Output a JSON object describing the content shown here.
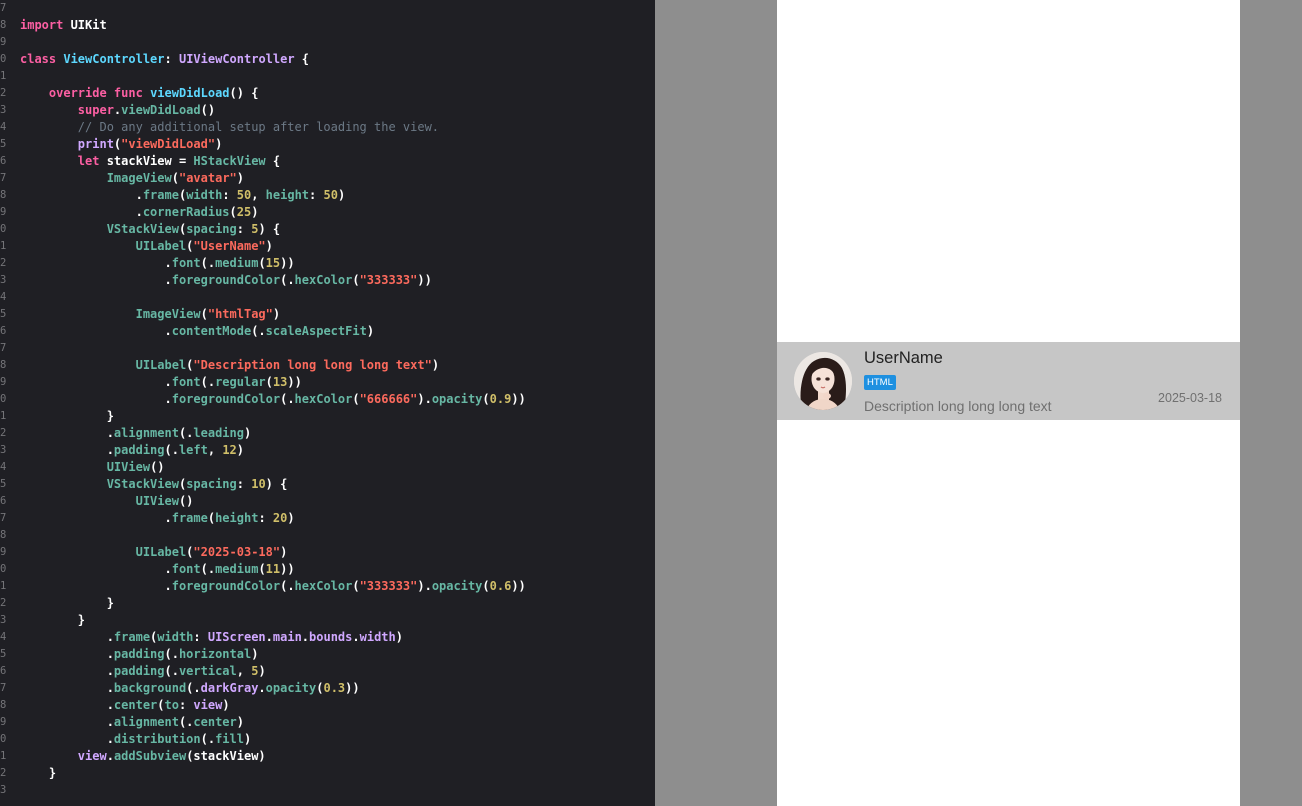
{
  "editor": {
    "lines": [
      {
        "n": "7",
        "tokens": []
      },
      {
        "n": "8",
        "tokens": [
          [
            "kw",
            "import"
          ],
          [
            "pl",
            " UIKit"
          ]
        ]
      },
      {
        "n": "9",
        "tokens": []
      },
      {
        "n": "0",
        "tokens": [
          [
            "kw",
            "class"
          ],
          [
            "pl",
            " "
          ],
          [
            "ty",
            "ViewController"
          ],
          [
            "pl",
            ": "
          ],
          [
            "lib",
            "UIViewController"
          ],
          [
            "pl",
            " {"
          ]
        ]
      },
      {
        "n": "1",
        "tokens": []
      },
      {
        "n": "2",
        "tokens": [
          [
            "pl",
            "    "
          ],
          [
            "kw",
            "override func"
          ],
          [
            "pl",
            " "
          ],
          [
            "ty",
            "viewDidLoad"
          ],
          [
            "pl",
            "() {"
          ]
        ]
      },
      {
        "n": "3",
        "tokens": [
          [
            "pl",
            "        "
          ],
          [
            "kw",
            "super"
          ],
          [
            "pl",
            "."
          ],
          [
            "mem",
            "viewDidLoad"
          ],
          [
            "pl",
            "()"
          ]
        ]
      },
      {
        "n": "4",
        "tokens": [
          [
            "pl",
            "        "
          ],
          [
            "cmt",
            "// Do any additional setup after loading the view."
          ]
        ]
      },
      {
        "n": "5",
        "tokens": [
          [
            "pl",
            "        "
          ],
          [
            "lib",
            "print"
          ],
          [
            "pl",
            "("
          ],
          [
            "str",
            "\"viewDidLoad\""
          ],
          [
            "pl",
            ")"
          ]
        ]
      },
      {
        "n": "6",
        "tokens": [
          [
            "pl",
            "        "
          ],
          [
            "kw",
            "let"
          ],
          [
            "pl",
            " stackView = "
          ],
          [
            "mem",
            "HStackView"
          ],
          [
            "pl",
            " {"
          ]
        ]
      },
      {
        "n": "7",
        "tokens": [
          [
            "pl",
            "            "
          ],
          [
            "mem",
            "ImageView"
          ],
          [
            "pl",
            "("
          ],
          [
            "str",
            "\"avatar\""
          ],
          [
            "pl",
            ")"
          ]
        ]
      },
      {
        "n": "8",
        "tokens": [
          [
            "pl",
            "                ."
          ],
          [
            "mem",
            "frame"
          ],
          [
            "pl",
            "("
          ],
          [
            "mem",
            "width"
          ],
          [
            "pl",
            ": "
          ],
          [
            "num",
            "50"
          ],
          [
            "pl",
            ", "
          ],
          [
            "mem",
            "height"
          ],
          [
            "pl",
            ": "
          ],
          [
            "num",
            "50"
          ],
          [
            "pl",
            ")"
          ]
        ]
      },
      {
        "n": "9",
        "tokens": [
          [
            "pl",
            "                ."
          ],
          [
            "mem",
            "cornerRadius"
          ],
          [
            "pl",
            "("
          ],
          [
            "num",
            "25"
          ],
          [
            "pl",
            ")"
          ]
        ]
      },
      {
        "n": "0",
        "tokens": [
          [
            "pl",
            "            "
          ],
          [
            "mem",
            "VStackView"
          ],
          [
            "pl",
            "("
          ],
          [
            "mem",
            "spacing"
          ],
          [
            "pl",
            ": "
          ],
          [
            "num",
            "5"
          ],
          [
            "pl",
            ") {"
          ]
        ]
      },
      {
        "n": "1",
        "tokens": [
          [
            "pl",
            "                "
          ],
          [
            "mem",
            "UILabel"
          ],
          [
            "pl",
            "("
          ],
          [
            "str",
            "\"UserName\""
          ],
          [
            "pl",
            ")"
          ]
        ]
      },
      {
        "n": "2",
        "tokens": [
          [
            "pl",
            "                    ."
          ],
          [
            "mem",
            "font"
          ],
          [
            "pl",
            "(."
          ],
          [
            "mem",
            "medium"
          ],
          [
            "pl",
            "("
          ],
          [
            "num",
            "15"
          ],
          [
            "pl",
            "))"
          ]
        ]
      },
      {
        "n": "3",
        "tokens": [
          [
            "pl",
            "                    ."
          ],
          [
            "mem",
            "foregroundColor"
          ],
          [
            "pl",
            "(."
          ],
          [
            "mem",
            "hexColor"
          ],
          [
            "pl",
            "("
          ],
          [
            "str",
            "\"333333\""
          ],
          [
            "pl",
            "))"
          ]
        ]
      },
      {
        "n": "4",
        "tokens": []
      },
      {
        "n": "5",
        "tokens": [
          [
            "pl",
            "                "
          ],
          [
            "mem",
            "ImageView"
          ],
          [
            "pl",
            "("
          ],
          [
            "str",
            "\"htmlTag\""
          ],
          [
            "pl",
            ")"
          ]
        ]
      },
      {
        "n": "6",
        "tokens": [
          [
            "pl",
            "                    ."
          ],
          [
            "mem",
            "contentMode"
          ],
          [
            "pl",
            "(."
          ],
          [
            "mem",
            "scaleAspectFit"
          ],
          [
            "pl",
            ")"
          ]
        ]
      },
      {
        "n": "7",
        "tokens": []
      },
      {
        "n": "8",
        "tokens": [
          [
            "pl",
            "                "
          ],
          [
            "mem",
            "UILabel"
          ],
          [
            "pl",
            "("
          ],
          [
            "str",
            "\"Description long long long text\""
          ],
          [
            "pl",
            ")"
          ]
        ]
      },
      {
        "n": "9",
        "tokens": [
          [
            "pl",
            "                    ."
          ],
          [
            "mem",
            "font"
          ],
          [
            "pl",
            "(."
          ],
          [
            "mem",
            "regular"
          ],
          [
            "pl",
            "("
          ],
          [
            "num",
            "13"
          ],
          [
            "pl",
            "))"
          ]
        ]
      },
      {
        "n": "0",
        "tokens": [
          [
            "pl",
            "                    ."
          ],
          [
            "mem",
            "foregroundColor"
          ],
          [
            "pl",
            "(."
          ],
          [
            "mem",
            "hexColor"
          ],
          [
            "pl",
            "("
          ],
          [
            "str",
            "\"666666\""
          ],
          [
            "pl",
            ")."
          ],
          [
            "mem",
            "opacity"
          ],
          [
            "pl",
            "("
          ],
          [
            "num",
            "0.9"
          ],
          [
            "pl",
            "))"
          ]
        ]
      },
      {
        "n": "1",
        "tokens": [
          [
            "pl",
            "            }"
          ]
        ]
      },
      {
        "n": "2",
        "tokens": [
          [
            "pl",
            "            ."
          ],
          [
            "mem",
            "alignment"
          ],
          [
            "pl",
            "(."
          ],
          [
            "mem",
            "leading"
          ],
          [
            "pl",
            ")"
          ]
        ]
      },
      {
        "n": "3",
        "tokens": [
          [
            "pl",
            "            ."
          ],
          [
            "mem",
            "padding"
          ],
          [
            "pl",
            "(."
          ],
          [
            "mem",
            "left"
          ],
          [
            "pl",
            ", "
          ],
          [
            "num",
            "12"
          ],
          [
            "pl",
            ")"
          ]
        ]
      },
      {
        "n": "4",
        "tokens": [
          [
            "pl",
            "            "
          ],
          [
            "mem",
            "UIView"
          ],
          [
            "pl",
            "()"
          ]
        ]
      },
      {
        "n": "5",
        "tokens": [
          [
            "pl",
            "            "
          ],
          [
            "mem",
            "VStackView"
          ],
          [
            "pl",
            "("
          ],
          [
            "mem",
            "spacing"
          ],
          [
            "pl",
            ": "
          ],
          [
            "num",
            "10"
          ],
          [
            "pl",
            ") {"
          ]
        ]
      },
      {
        "n": "6",
        "tokens": [
          [
            "pl",
            "                "
          ],
          [
            "mem",
            "UIView"
          ],
          [
            "pl",
            "()"
          ]
        ]
      },
      {
        "n": "7",
        "tokens": [
          [
            "pl",
            "                    ."
          ],
          [
            "mem",
            "frame"
          ],
          [
            "pl",
            "("
          ],
          [
            "mem",
            "height"
          ],
          [
            "pl",
            ": "
          ],
          [
            "num",
            "20"
          ],
          [
            "pl",
            ")"
          ]
        ]
      },
      {
        "n": "8",
        "tokens": []
      },
      {
        "n": "9",
        "tokens": [
          [
            "pl",
            "                "
          ],
          [
            "mem",
            "UILabel"
          ],
          [
            "pl",
            "("
          ],
          [
            "str",
            "\"2025-03-18\""
          ],
          [
            "pl",
            ")"
          ]
        ]
      },
      {
        "n": "0",
        "tokens": [
          [
            "pl",
            "                    ."
          ],
          [
            "mem",
            "font"
          ],
          [
            "pl",
            "(."
          ],
          [
            "mem",
            "medium"
          ],
          [
            "pl",
            "("
          ],
          [
            "num",
            "11"
          ],
          [
            "pl",
            "))"
          ]
        ]
      },
      {
        "n": "1",
        "tokens": [
          [
            "pl",
            "                    ."
          ],
          [
            "mem",
            "foregroundColor"
          ],
          [
            "pl",
            "(."
          ],
          [
            "mem",
            "hexColor"
          ],
          [
            "pl",
            "("
          ],
          [
            "str",
            "\"333333\""
          ],
          [
            "pl",
            ")."
          ],
          [
            "mem",
            "opacity"
          ],
          [
            "pl",
            "("
          ],
          [
            "num",
            "0.6"
          ],
          [
            "pl",
            "))"
          ]
        ]
      },
      {
        "n": "2",
        "tokens": [
          [
            "pl",
            "            }"
          ]
        ]
      },
      {
        "n": "3",
        "tokens": [
          [
            "pl",
            "        }"
          ]
        ]
      },
      {
        "n": "4",
        "tokens": [
          [
            "pl",
            "            ."
          ],
          [
            "mem",
            "frame"
          ],
          [
            "pl",
            "("
          ],
          [
            "mem",
            "width"
          ],
          [
            "pl",
            ": "
          ],
          [
            "lib",
            "UIScreen"
          ],
          [
            "pl",
            "."
          ],
          [
            "lib",
            "main"
          ],
          [
            "pl",
            "."
          ],
          [
            "lib",
            "bounds"
          ],
          [
            "pl",
            "."
          ],
          [
            "lib",
            "width"
          ],
          [
            "pl",
            ")"
          ]
        ]
      },
      {
        "n": "5",
        "tokens": [
          [
            "pl",
            "            ."
          ],
          [
            "mem",
            "padding"
          ],
          [
            "pl",
            "(."
          ],
          [
            "mem",
            "horizontal"
          ],
          [
            "pl",
            ")"
          ]
        ]
      },
      {
        "n": "6",
        "tokens": [
          [
            "pl",
            "            ."
          ],
          [
            "mem",
            "padding"
          ],
          [
            "pl",
            "(."
          ],
          [
            "mem",
            "vertical"
          ],
          [
            "pl",
            ", "
          ],
          [
            "num",
            "5"
          ],
          [
            "pl",
            ")"
          ]
        ]
      },
      {
        "n": "7",
        "tokens": [
          [
            "pl",
            "            ."
          ],
          [
            "mem",
            "background"
          ],
          [
            "pl",
            "(."
          ],
          [
            "lib",
            "darkGray"
          ],
          [
            "pl",
            "."
          ],
          [
            "mem",
            "opacity"
          ],
          [
            "pl",
            "("
          ],
          [
            "num",
            "0.3"
          ],
          [
            "pl",
            "))"
          ]
        ]
      },
      {
        "n": "8",
        "tokens": [
          [
            "pl",
            "            ."
          ],
          [
            "mem",
            "center"
          ],
          [
            "pl",
            "("
          ],
          [
            "mem",
            "to"
          ],
          [
            "pl",
            ": "
          ],
          [
            "lib",
            "view"
          ],
          [
            "pl",
            ")"
          ]
        ]
      },
      {
        "n": "9",
        "tokens": [
          [
            "pl",
            "            ."
          ],
          [
            "mem",
            "alignment"
          ],
          [
            "pl",
            "(."
          ],
          [
            "mem",
            "center"
          ],
          [
            "pl",
            ")"
          ]
        ]
      },
      {
        "n": "0",
        "tokens": [
          [
            "pl",
            "            ."
          ],
          [
            "mem",
            "distribution"
          ],
          [
            "pl",
            "(."
          ],
          [
            "mem",
            "fill"
          ],
          [
            "pl",
            ")"
          ]
        ]
      },
      {
        "n": "1",
        "tokens": [
          [
            "pl",
            "        "
          ],
          [
            "lib",
            "view"
          ],
          [
            "pl",
            "."
          ],
          [
            "mem",
            "addSubview"
          ],
          [
            "pl",
            "(stackView)"
          ]
        ]
      },
      {
        "n": "2",
        "tokens": [
          [
            "pl",
            "    }"
          ]
        ]
      },
      {
        "n": "3",
        "tokens": []
      }
    ]
  },
  "preview": {
    "username": "UserName",
    "tag": "HTML",
    "description": "Description long long long text",
    "date": "2025-03-18",
    "avatar_icon": "avatar-portrait"
  },
  "colors": {
    "editor_bg": "#1f1f24",
    "keyword": "#fc5fa3",
    "type": "#5dd8ff",
    "string": "#fc6a5d",
    "number": "#d0bf69",
    "tag_blue": "#1e90e0",
    "row_bg": "#c6c6c6"
  }
}
